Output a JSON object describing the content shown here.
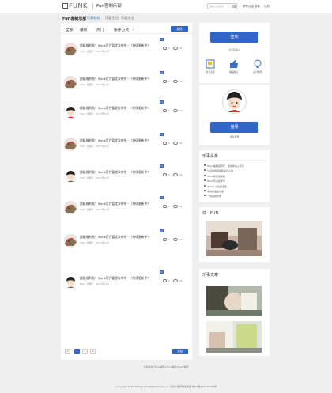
{
  "header": {
    "logo_text": "FUNK",
    "site_name": "Fun客制乐部",
    "search_placeholder": "请输入关键词",
    "top_links": [
      "帮帮对话",
      "登录",
      "注册"
    ]
  },
  "subnav": {
    "title": "Fun客制乐部",
    "items": [
      "乐客轻松",
      "乐客生活",
      "乐客文艺"
    ]
  },
  "feed": {
    "tabs": [
      "全部",
      "最新",
      "热门",
      "排序方式"
    ],
    "post_button": "发帖",
    "posts": [
      {
        "title": "超级福利贴！iFunk官方暂优发布啦~（持续更新中）",
        "author": "Hiter",
        "group": "管理员",
        "date": "2017年11月",
        "avatar": "dog",
        "comments": "1",
        "views": "111"
      },
      {
        "title": "超级福利贴！iFunk官方暂优发布啦~（持续更新中）",
        "author": "Hiter",
        "group": "管理员",
        "date": "2017年11月",
        "avatar": "dog",
        "comments": "1",
        "views": "111"
      },
      {
        "title": "超级福利贴！iFunk官方暂优发布啦~（持续更新中）",
        "author": "Hiter",
        "group": "管理员",
        "date": "2017年11月",
        "avatar": "boy",
        "comments": "1",
        "views": "111"
      },
      {
        "title": "超级福利贴！iFunk官方暂优发布啦~（持续更新中）",
        "author": "Hiter",
        "group": "管理员",
        "date": "2017年11月",
        "avatar": "dog",
        "comments": "1",
        "views": "111"
      },
      {
        "title": "超级福利贴！iFunk官方暂优发布啦~（持续更新中）",
        "author": "Hiter",
        "group": "管理员",
        "date": "2017年11月",
        "avatar": "boy",
        "comments": "1",
        "views": "111"
      },
      {
        "title": "超级福利贴！iFunk官方暂优发布啦~（持续更新中）",
        "author": "Hiter",
        "group": "管理员",
        "date": "2017年11月",
        "avatar": "dog",
        "comments": "1",
        "views": "111"
      },
      {
        "title": "超级福利贴！iFunk官方暂优发布啦~（持续更新中）",
        "author": "Hiter",
        "group": "管理员",
        "date": "2017年11月",
        "avatar": "dog",
        "comments": "1",
        "views": "111"
      },
      {
        "title": "超级福利贴！iFunk官方暂优发布啦~（持续更新中）",
        "author": "Hiter",
        "group": "管理员",
        "date": "2017年11月",
        "avatar": "boy",
        "comments": "1",
        "views": "111"
      }
    ],
    "pager": {
      "prev": "<",
      "pages": [
        "1",
        "2",
        "3"
      ],
      "current": "1",
      "next": ">",
      "post_button": "发帖"
    }
  },
  "sidebar": {
    "sign_button": "签到",
    "sign_text": "今日签到人",
    "icons": [
      {
        "label": "新手主题",
        "icon": "book-icon"
      },
      {
        "label": "精品帖子",
        "icon": "thumbs-up-icon"
      },
      {
        "label": "设计规则",
        "icon": "bulb-icon"
      }
    ],
    "login_button": "登录",
    "login_text": "请先登录",
    "news_title": "乐事头条",
    "news": [
      "iFunk暑期招聘开，邀请你加入乐享",
      "分享你的装备和设计心得",
      "iFunk新款悦读机",
      "iFunk乐享嘉年华",
      "iFunk1人在线活动",
      "冲向新品发布会",
      "一周最新优惠"
    ],
    "fun_title": "炫　FUN",
    "article_title": "乐事文章"
  },
  "footer": {
    "links": "友情链接 iFunk官网 iFunk官网 iFunk官网",
    "copyright": "Copyright 2010-2017 (c) All Rights Reserved. 请用户遵守相关法律",
    "icp": "浙ICP备123456789号"
  }
}
